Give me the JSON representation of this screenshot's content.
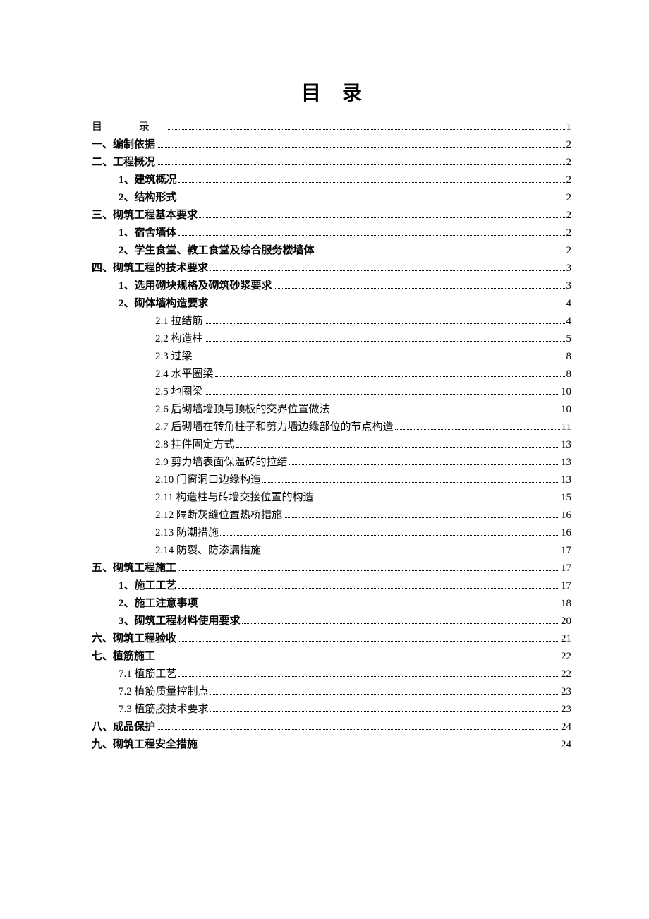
{
  "title": "目录",
  "toc": [
    {
      "label": "目    录",
      "page": "1",
      "indent": 0,
      "bold": false,
      "special": "mulu"
    },
    {
      "label": "一、编制依据",
      "page": "2",
      "indent": 0,
      "bold": true
    },
    {
      "label": "二、工程概况",
      "page": "2",
      "indent": 0,
      "bold": true
    },
    {
      "label": "1、建筑概况",
      "page": "2",
      "indent": 1,
      "bold": true
    },
    {
      "label": "2、结构形式",
      "page": "2",
      "indent": 1,
      "bold": true
    },
    {
      "label": "三、砌筑工程基本要求",
      "page": "2",
      "indent": 0,
      "bold": true
    },
    {
      "label": "1、宿舍墙体",
      "page": "2",
      "indent": 1,
      "bold": true
    },
    {
      "label": "2、学生食堂、教工食堂及综合服务楼墙体",
      "page": "2",
      "indent": 1,
      "bold": true
    },
    {
      "label": "四、砌筑工程的技术要求",
      "page": "3",
      "indent": 0,
      "bold": true
    },
    {
      "label": "1、选用砌块规格及砌筑砂浆要求",
      "page": "3",
      "indent": 1,
      "bold": true
    },
    {
      "label": "2、砌体墙构造要求",
      "page": "4",
      "indent": 1,
      "bold": true
    },
    {
      "label": "2.1 拉结筋",
      "page": "4",
      "indent": 2,
      "bold": false
    },
    {
      "label": "2.2 构造柱",
      "page": "5",
      "indent": 2,
      "bold": false
    },
    {
      "label": "2.3 过梁",
      "page": "8",
      "indent": 2,
      "bold": false
    },
    {
      "label": "2.4 水平圈梁",
      "page": "8",
      "indent": 2,
      "bold": false
    },
    {
      "label": "2.5 地圈梁",
      "page": "10",
      "indent": 2,
      "bold": false
    },
    {
      "label": "2.6 后砌墙墙顶与顶板的交界位置做法",
      "page": "10",
      "indent": 2,
      "bold": false
    },
    {
      "label": "2.7 后砌墙在转角柱子和剪力墙边缘部位的节点构造",
      "page": "11",
      "indent": 2,
      "bold": false
    },
    {
      "label": "2.8 挂件固定方式",
      "page": "13",
      "indent": 2,
      "bold": false
    },
    {
      "label": "2.9 剪力墙表面保温砖的拉结",
      "page": "13",
      "indent": 2,
      "bold": false
    },
    {
      "label": "2.10 门窗洞口边缘构造",
      "page": "13",
      "indent": 2,
      "bold": false
    },
    {
      "label": "2.11 构造柱与砖墙交接位置的构造",
      "page": "15",
      "indent": 2,
      "bold": false
    },
    {
      "label": "2.12 隔断灰缝位置热桥措施",
      "page": "16",
      "indent": 2,
      "bold": false
    },
    {
      "label": "2.13 防潮措施",
      "page": "16",
      "indent": 2,
      "bold": false
    },
    {
      "label": "2.14 防裂、防渗漏措施",
      "page": "17",
      "indent": 2,
      "bold": false
    },
    {
      "label": "五、砌筑工程施工",
      "page": "17",
      "indent": 0,
      "bold": true
    },
    {
      "label": "1、施工工艺",
      "page": "17",
      "indent": 1,
      "bold": true
    },
    {
      "label": "2、施工注意事项",
      "page": "18",
      "indent": 1,
      "bold": true
    },
    {
      "label": "3、砌筑工程材料使用要求",
      "page": "20",
      "indent": 1,
      "bold": true
    },
    {
      "label": "六、砌筑工程验收",
      "page": "21",
      "indent": 0,
      "bold": true
    },
    {
      "label": "七、植筋施工",
      "page": "22",
      "indent": 0,
      "bold": true
    },
    {
      "label": "7.1 植筋工艺",
      "page": "22",
      "indent": 1,
      "bold": false
    },
    {
      "label": "7.2 植筋质量控制点",
      "page": "23",
      "indent": 1,
      "bold": false
    },
    {
      "label": "7.3 植筋胶技术要求",
      "page": "23",
      "indent": 1,
      "bold": false
    },
    {
      "label": "八、成品保护",
      "page": "24",
      "indent": 0,
      "bold": true
    },
    {
      "label": "九、砌筑工程安全措施",
      "page": "24",
      "indent": 0,
      "bold": true
    }
  ]
}
